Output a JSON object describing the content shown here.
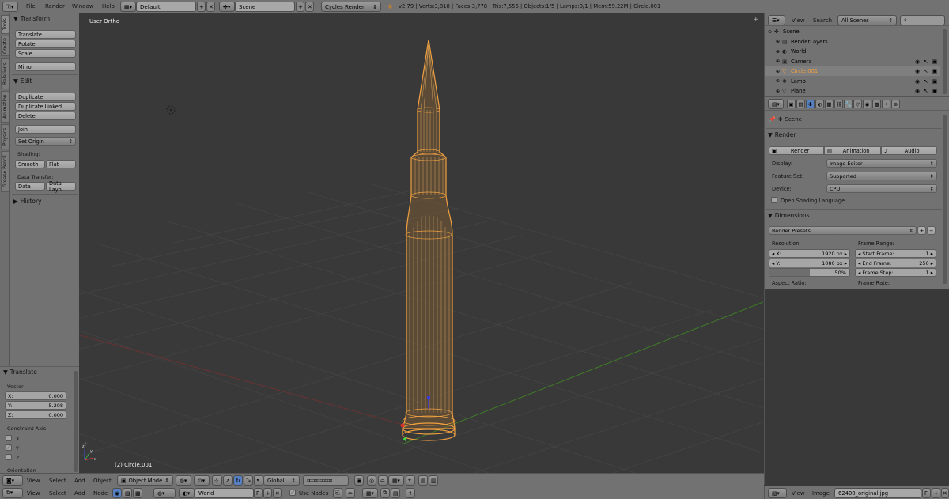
{
  "topbar": {
    "menus": [
      "File",
      "Render",
      "Window",
      "Help"
    ],
    "screen_layout": "Default",
    "scene": "Scene",
    "render_engine": "Cycles Render",
    "info": "v2.79 | Verts:3,818 | Faces:3,778 | Tris:7,556 | Objects:1/5 | Lamps:0/1 | Mem:59.22M | Circle.001"
  },
  "tool_tabs": [
    "Tools",
    "Create",
    "Relations",
    "Animation",
    "Physics",
    "Grease Pencil"
  ],
  "toolshelf": {
    "transform_header": "Transform",
    "translate": "Translate",
    "rotate": "Rotate",
    "scale": "Scale",
    "mirror": "Mirror",
    "edit_header": "Edit",
    "duplicate": "Duplicate",
    "duplicate_linked": "Duplicate Linked",
    "delete": "Delete",
    "join": "Join",
    "set_origin": "Set Origin",
    "shading_label": "Shading:",
    "smooth": "Smooth",
    "flat": "Flat",
    "data_transfer_label": "Data Transfer:",
    "data": "Data",
    "data_layout": "Data Layo",
    "history_header": "History"
  },
  "operator": {
    "header": "Translate",
    "vector_label": "Vector",
    "x_label": "X:",
    "x_value": "0.000",
    "y_label": "Y:",
    "y_value": "-5.208",
    "z_label": "Z:",
    "z_value": "0.000",
    "constraint_label": "Constraint Axis",
    "axis_x": "X",
    "axis_y": "Y",
    "axis_z": "Z",
    "axis_x_checked": false,
    "axis_y_checked": true,
    "axis_z_checked": false,
    "orientation_label": "Orientation"
  },
  "viewport": {
    "view_name": "User Ortho",
    "object_info": "(2) Circle.001"
  },
  "view3d_header": {
    "menus": [
      "View",
      "Select",
      "Add",
      "Object"
    ],
    "mode": "Object Mode",
    "orientation": "Global"
  },
  "node_header": {
    "menus": [
      "View",
      "Select",
      "Add",
      "Node"
    ],
    "world": "World",
    "fake_user": "F",
    "use_nodes": "Use Nodes"
  },
  "outliner": {
    "menus": [
      "View",
      "Search"
    ],
    "display": "All Scenes",
    "items": [
      {
        "name": "Scene",
        "indent": 0
      },
      {
        "name": "RenderLayers",
        "indent": 1
      },
      {
        "name": "World",
        "indent": 1
      },
      {
        "name": "Camera",
        "indent": 1
      },
      {
        "name": "Circle.001",
        "indent": 1
      },
      {
        "name": "Lamp",
        "indent": 1
      },
      {
        "name": "Plane",
        "indent": 1
      }
    ]
  },
  "properties": {
    "context": "Scene",
    "render_header": "Render",
    "render_btn": "Render",
    "animation_btn": "Animation",
    "audio_btn": "Audio",
    "display_label": "Display:",
    "display_value": "Image Editor",
    "feature_label": "Feature Set:",
    "feature_value": "Supported",
    "device_label": "Device:",
    "device_value": "CPU",
    "osl_label": "Open Shading Language",
    "dimensions_header": "Dimensions",
    "render_presets": "Render Presets",
    "resolution_label": "Resolution:",
    "res_x_label": "X:",
    "res_x": "1920 px",
    "res_y_label": "Y:",
    "res_y": "1080 px",
    "res_pct": "50%",
    "res_pct_fraction": 0.5,
    "frame_range_label": "Frame Range:",
    "start_label": "Start Frame:",
    "start": "1",
    "end_label": "End Frame:",
    "end": "250",
    "step_label": "Frame Step:",
    "step": "1",
    "aspect_label": "Aspect Ratio:",
    "frame_rate_label": "Frame Rate:"
  },
  "image_header": {
    "menus": [
      "View",
      "Image"
    ],
    "image_name": "62400_original.jpg",
    "fake_user": "F"
  },
  "colors": {
    "selection": "#f0a040",
    "viewport_bg": "#393939",
    "panel_bg": "#727272",
    "x_axis": "#8a3a3a",
    "y_axis": "#4a8a2a"
  }
}
